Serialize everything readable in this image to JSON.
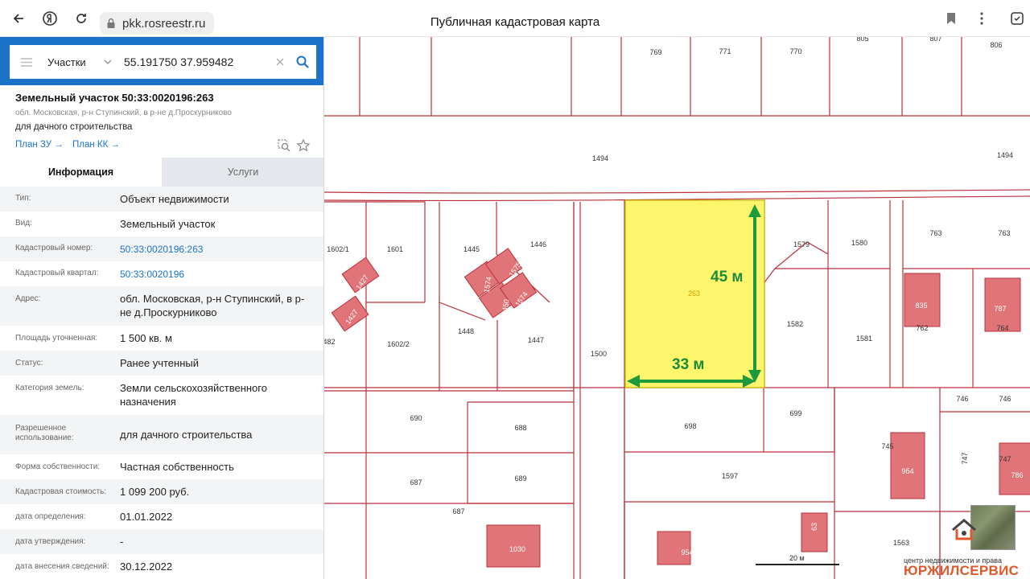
{
  "browser": {
    "url": "pkk.rosreestr.ru",
    "tab_title": "Публичная кадастровая карта"
  },
  "search": {
    "layer": "Участки",
    "query": "55.191750 37.959482"
  },
  "object": {
    "title": "Земельный участок 50:33:0020196:263",
    "address_short": "обл. Московская, р-н Ступинский, в р-не д.Проскурниково",
    "use_short": "для дачного строительства",
    "links": [
      "План ЗУ →",
      "План КК →"
    ]
  },
  "tabs": [
    "Информация",
    "Услуги"
  ],
  "info": [
    {
      "label": "Тип:",
      "value": "Объект недвижимости"
    },
    {
      "label": "Вид:",
      "value": "Земельный участок"
    },
    {
      "label": "Кадастровый номер:",
      "value": "50:33:0020196:263"
    },
    {
      "label": "Кадастровый квартал:",
      "value": "50:33:0020196"
    },
    {
      "label": "Адрес:",
      "value": "обл. Московская, р-н Ступинский, в р-не д.Проскурниково"
    },
    {
      "label": "Площадь уточненная:",
      "value": "1 500 кв. м"
    },
    {
      "label": "Статус:",
      "value": "Ранее учтенный"
    },
    {
      "label": "Категория земель:",
      "value": "Земли сельскохозяйственного назначения"
    },
    {
      "label": "Разрешенное использование:",
      "value": "для дачного строительства"
    },
    {
      "label": "Форма собственности:",
      "value": "Частная собственность"
    },
    {
      "label": "Кадастровая стоимость:",
      "value": "1 099 200 руб."
    },
    {
      "label": "дата определения:",
      "value": "01.01.2022"
    },
    {
      "label": "дата утверждения:",
      "value": "-"
    },
    {
      "label": "дата внесения сведений:",
      "value": "30.12.2022"
    }
  ],
  "map": {
    "selected_plot": "263",
    "dimension_height": "45 м",
    "dimension_width": "33 м",
    "scale": "20 м",
    "plot_labels": [
      "769",
      "771",
      "770",
      "805",
      "807",
      "806",
      "1494",
      "1494",
      "1602/1",
      "1601",
      "1445",
      "1446",
      "1579",
      "1580",
      "763",
      "763",
      "482",
      "1602/2",
      "1448",
      "1447",
      "1500",
      "1582",
      "1581",
      "762",
      "764",
      "746",
      "746",
      "690",
      "688",
      "698",
      "699",
      "745",
      "747",
      "747",
      "687",
      "689",
      "1597",
      "687",
      "1563"
    ],
    "building_labels": [
      "1427",
      "1427",
      "1574",
      "1575",
      "1450",
      "1574",
      "835",
      "787",
      "1030",
      "954",
      "9б4",
      "786",
      "63"
    ],
    "watermark": "центр недвижимости и права",
    "brand": "ЮРЖИЛСЕРВИС"
  }
}
